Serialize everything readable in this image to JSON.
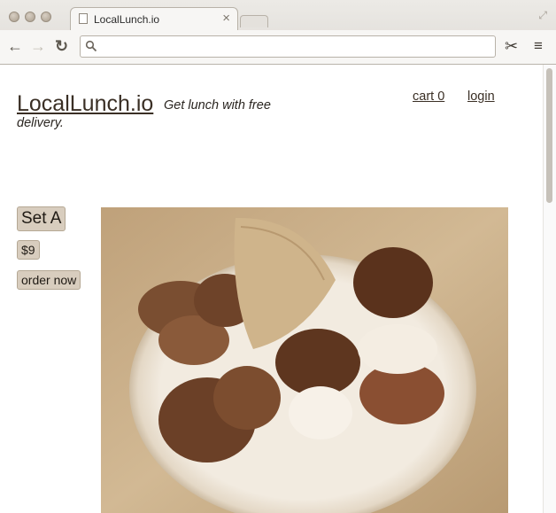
{
  "browser": {
    "tab_title": "LocalLunch.io",
    "tab_close": "×",
    "address_value": ""
  },
  "icons": {
    "back": "←",
    "forward": "→",
    "reload": "↻",
    "scissors": "✂",
    "menu": "≡",
    "resize": "⤢"
  },
  "site": {
    "brand": "LocalLunch.io",
    "tagline": "Get lunch with free delivery.",
    "cart_link": "cart 0",
    "login_link": "login"
  },
  "product": {
    "name": "Set A",
    "price": "$9",
    "order_button": "order now"
  },
  "colors": {
    "brand_text": "#3a2f25",
    "tag_background": "#d8cdbe",
    "photo_tone": "sepia"
  }
}
